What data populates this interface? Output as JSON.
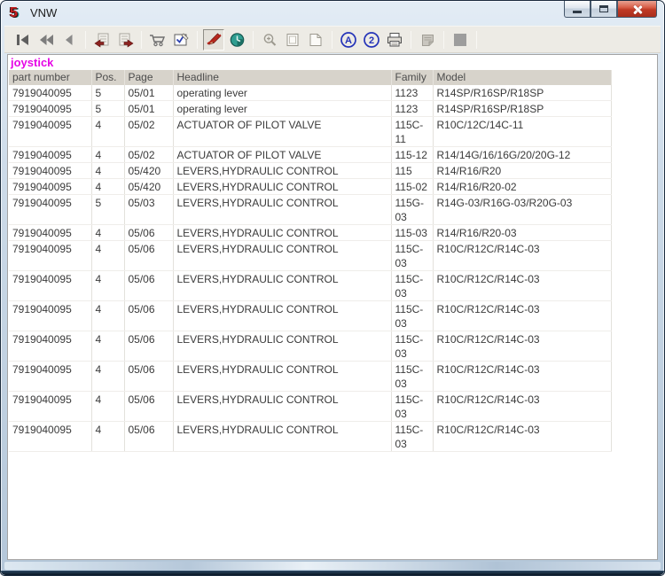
{
  "window": {
    "logo_text": "5",
    "title": "VNW",
    "controls": [
      "minimize",
      "maximize",
      "close"
    ]
  },
  "toolbar": {
    "icons": [
      "go-to-first",
      "fast-backward",
      "back",
      "document-with-arrow-left",
      "document-with-arrow-right",
      "shopping-cart",
      "order-form-check",
      "hide-annotations-pen",
      "globe-clock",
      "zoom-magnifier",
      "page-view",
      "page-view-folded",
      "circled-a",
      "circled-2",
      "printer",
      "notes-pad",
      "gray-swatch"
    ],
    "pressed_icon": "hide-annotations-pen"
  },
  "search_term": "joystick",
  "table": {
    "columns": [
      {
        "key": "part",
        "label": "part number"
      },
      {
        "key": "pos",
        "label": "Pos."
      },
      {
        "key": "page",
        "label": "Page"
      },
      {
        "key": "headline",
        "label": "Headline"
      },
      {
        "key": "family",
        "label": "Family"
      },
      {
        "key": "model",
        "label": "Model"
      }
    ],
    "rows": [
      {
        "part": "7919040095",
        "pos": "5",
        "page": "05/01",
        "headline": "operating lever",
        "family": "1123",
        "model": "R14SP/R16SP/R18SP"
      },
      {
        "part": "7919040095",
        "pos": "5",
        "page": "05/01",
        "headline": "operating lever",
        "family": "1123",
        "model": "R14SP/R16SP/R18SP"
      },
      {
        "part": "7919040095",
        "pos": "4",
        "page": "05/02",
        "headline": "ACTUATOR OF PILOT VALVE",
        "family": "115C-11",
        "model": "R10C/12C/14C-11"
      },
      {
        "part": "7919040095",
        "pos": "4",
        "page": "05/02",
        "headline": "ACTUATOR OF PILOT VALVE",
        "family": "115-12",
        "model": "R14/14G/16/16G/20/20G-12"
      },
      {
        "part": "7919040095",
        "pos": "4",
        "page": "05/420",
        "headline": "LEVERS,HYDRAULIC CONTROL",
        "family": "115",
        "model": "R14/R16/R20"
      },
      {
        "part": "7919040095",
        "pos": "4",
        "page": "05/420",
        "headline": "LEVERS,HYDRAULIC CONTROL",
        "family": "115-02",
        "model": "R14/R16/R20-02"
      },
      {
        "part": "7919040095",
        "pos": "5",
        "page": "05/03",
        "headline": "LEVERS,HYDRAULIC CONTROL",
        "family": "115G-\n03",
        "model": "R14G-03/R16G-03/R20G-03"
      },
      {
        "part": "7919040095",
        "pos": "4",
        "page": "05/06",
        "headline": "LEVERS,HYDRAULIC CONTROL",
        "family": "115-03",
        "model": "R14/R16/R20-03"
      },
      {
        "part": "7919040095",
        "pos": "4",
        "page": "05/06",
        "headline": "LEVERS,HYDRAULIC CONTROL",
        "family": "115C-03",
        "model": "R10C/R12C/R14C-03"
      },
      {
        "part": "7919040095",
        "pos": "4",
        "page": "05/06",
        "headline": "LEVERS,HYDRAULIC CONTROL",
        "family": "115C-03",
        "model": "R10C/R12C/R14C-03"
      },
      {
        "part": "7919040095",
        "pos": "4",
        "page": "05/06",
        "headline": "LEVERS,HYDRAULIC CONTROL",
        "family": "115C-03",
        "model": "R10C/R12C/R14C-03"
      },
      {
        "part": "7919040095",
        "pos": "4",
        "page": "05/06",
        "headline": "LEVERS,HYDRAULIC CONTROL",
        "family": "115C-03",
        "model": "R10C/R12C/R14C-03"
      },
      {
        "part": "7919040095",
        "pos": "4",
        "page": "05/06",
        "headline": "LEVERS,HYDRAULIC CONTROL",
        "family": "115C-03",
        "model": "R10C/R12C/R14C-03"
      },
      {
        "part": "7919040095",
        "pos": "4",
        "page": "05/06",
        "headline": "LEVERS,HYDRAULIC CONTROL",
        "family": "115C-03",
        "model": "R10C/R12C/R14C-03"
      },
      {
        "part": "7919040095",
        "pos": "4",
        "page": "05/06",
        "headline": "LEVERS,HYDRAULIC CONTROL",
        "family": "115C-03",
        "model": "R10C/R12C/R14C-03"
      }
    ]
  },
  "colors": {
    "link": "#3434c8",
    "search_term": "#e607e6",
    "header_bg": "#d7d3cb",
    "close_button": "#c03a26",
    "title_gradient_top": "#e3ecf5"
  }
}
